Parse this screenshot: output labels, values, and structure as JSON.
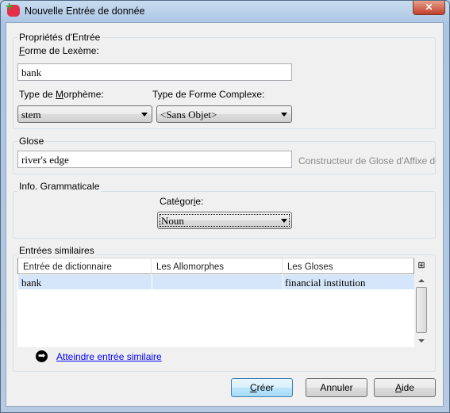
{
  "window": {
    "title": "Nouvelle Entrée de donnée",
    "close_icon": "close-icon"
  },
  "entry_props": {
    "group_label": "Propriétés d'Entrée",
    "lexeme_label_u": "F",
    "lexeme_label_rest": "orme de Lexème:",
    "lexeme_value": "bank",
    "morph_type_label_a": "Type de ",
    "morph_type_label_u": "M",
    "morph_type_label_b": "orphème:",
    "morph_type_value": "stem",
    "complex_form_label": "Type de Forme Complexe:",
    "complex_form_value": "<Sans Objet>"
  },
  "gloss": {
    "group_label": "Glose",
    "value": "river's edge",
    "builder_link": "Constructeur de Glose d'Affixe de F"
  },
  "grammar": {
    "group_label": "Info. Grammaticale",
    "category_label_a": "Catégor",
    "category_label_u": "i",
    "category_label_b": "e:",
    "category_value": "Noun"
  },
  "similar": {
    "group_label": "Entrées similaires",
    "columns": [
      "Entrée de dictionnaire",
      "Les Allomorphes",
      "Les Gloses"
    ],
    "rows": [
      {
        "entry": "bank",
        "allomorphs": "",
        "glosses": "financial institution"
      }
    ],
    "goto_link": "Atteindre entrée similaire"
  },
  "buttons": {
    "create_u": "C",
    "create_rest": "réer",
    "cancel": "Annuler",
    "help_u": "A",
    "help_rest": "ide"
  }
}
